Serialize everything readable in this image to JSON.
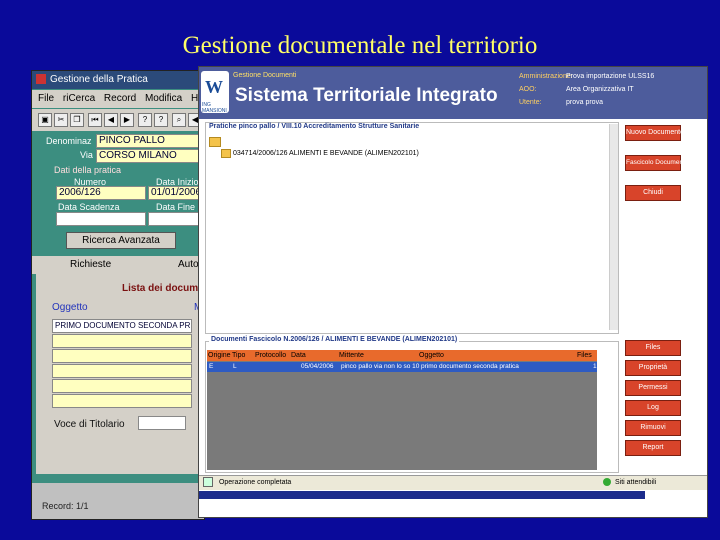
{
  "slide": {
    "title": "Gestione documentale nel territorio"
  },
  "back_window": {
    "title": "Gestione della Pratica",
    "menu": [
      "File",
      "riCerca",
      "Record",
      "Modifica",
      "He"
    ],
    "fields": {
      "denominaz_label": "Denominaz",
      "denominaz_value": "PINCO PALLO",
      "via_label": "Via",
      "via_value": "CORSO MILANO",
      "section_label": "Dati della pratica",
      "numero_label": "Numero",
      "numero_value": "2006/126",
      "data_inizio_label": "Data Inizio",
      "data_inizio_value": "01/01/2006",
      "data_scadenza_label": "Data Scadenza",
      "data_fine_label": "Data Fine"
    },
    "search_button": "Ricerca Avanzata",
    "tabs": [
      "Richieste",
      "Auto"
    ],
    "list_title": "Lista dei docum",
    "oggetto_label": "Oggetto",
    "m_label": "M",
    "first_row": "PRIMO DOCUMENTO SECONDA PR",
    "voce_label": "Voce di Titolario",
    "record": "Record: 1/1"
  },
  "front_window": {
    "header_small": "Gestione Documenti",
    "header_title": "Sistema Territoriale Integrato",
    "logo_letters": "W",
    "logo_caption": "ING MANSIONI",
    "info": [
      {
        "key": "Amministrazione:",
        "value": "Prova importazione ULSS16"
      },
      {
        "key": "AOO:",
        "value": "Area Organizzativa IT"
      },
      {
        "key": "Utente:",
        "value": "prova prova"
      }
    ],
    "group1_title": "Pratiche pinco pallo / VIII.10 Accreditamento Strutture Sanitarie",
    "tree_item": "034714/2006/126 ALIMENTI E BEVANDE (ALIMEN202101)",
    "group2_title": "Documenti Fascicolo N.2006/126 / ALIMENTI E BEVANDE (ALIMEN202101)",
    "table": {
      "headers": [
        "Origine",
        "Tipo",
        "Protocollo",
        "Data",
        "Mittente",
        "Oggetto",
        "Files"
      ],
      "rows": [
        [
          "E",
          "L",
          "",
          "05/04/2006",
          "pinco pallo via non lo so 10",
          "primo documento seconda pratica",
          "1"
        ]
      ]
    },
    "buttons_top": [
      "Nuovo Documento",
      "Fascicolo Documenti",
      "Chiudi"
    ],
    "buttons_bottom": [
      "Files",
      "Proprietà",
      "Permessi",
      "Log",
      "Rimuovi",
      "Report"
    ],
    "status_left": "Operazione completata",
    "status_right": "Siti attendibili"
  }
}
